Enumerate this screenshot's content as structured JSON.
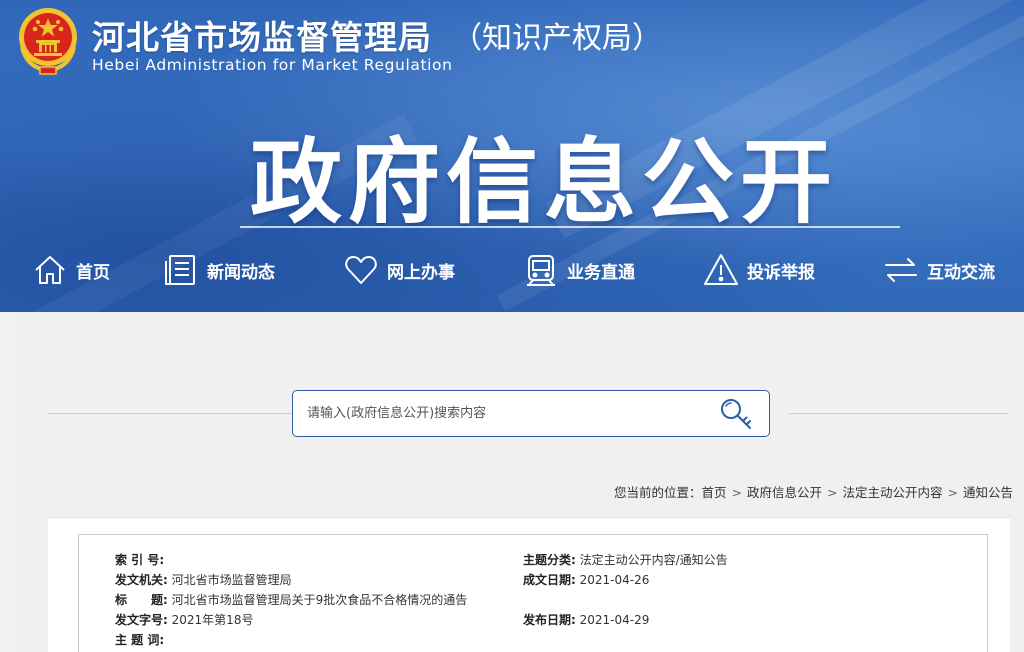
{
  "header": {
    "agency_cn": "河北省市场监督管理局",
    "agency_sub": "（知识产权局）",
    "agency_en": "Hebei Administration for Market Regulation",
    "hero_title": "政府信息公开"
  },
  "nav": [
    {
      "label": "首页",
      "icon": "home-icon"
    },
    {
      "label": "新闻动态",
      "icon": "news-icon"
    },
    {
      "label": "网上办事",
      "icon": "heart-icon"
    },
    {
      "label": "业务直通",
      "icon": "train-icon"
    },
    {
      "label": "投诉举报",
      "icon": "warning-icon"
    },
    {
      "label": "互动交流",
      "icon": "exchange-icon"
    }
  ],
  "search": {
    "placeholder": "请输入(政府信息公开)搜索内容",
    "value": ""
  },
  "breadcrumb": {
    "prefix": "您当前的位置：",
    "items": [
      "首页",
      "政府信息公开",
      "法定主动公开内容",
      "通知公告"
    ],
    "separator": ">"
  },
  "doc": {
    "index_label": "索 引 号:",
    "index_value": "",
    "category_label": "主题分类:",
    "category_value": "法定主动公开内容/通知公告",
    "issuer_label": "发文机关:",
    "issuer_value": "河北省市场监督管理局",
    "written_label": "成文日期:",
    "written_value": "2021-04-26",
    "title_label": "标　　题:",
    "title_value": "河北省市场监督管理局关于9批次食品不合格情况的通告",
    "docno_label": "发文字号:",
    "docno_value": "2021年第18号",
    "publish_label": "发布日期:",
    "publish_value": "2021-04-29",
    "keywords_label": "主 题 词:",
    "keywords_value": ""
  },
  "colors": {
    "banner_blue": "#3168b8",
    "search_border": "#2d5fa8",
    "emblem_red": "#d7261e",
    "emblem_gold": "#f2c230"
  }
}
